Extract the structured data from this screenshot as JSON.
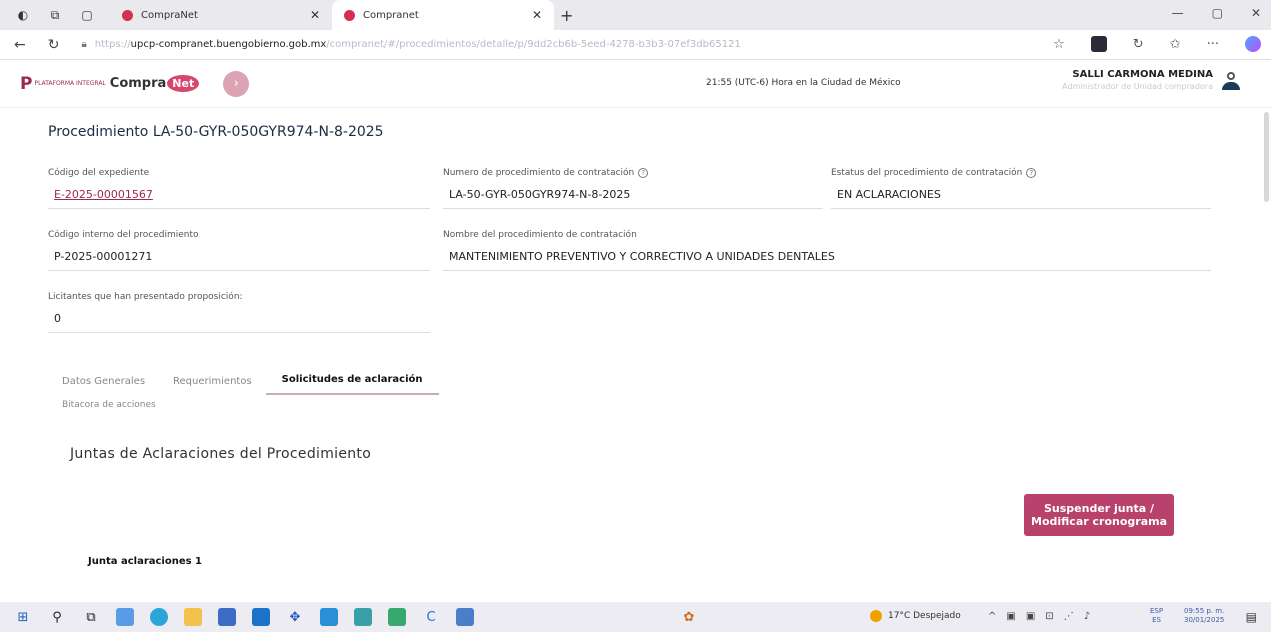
{
  "browser": {
    "tabs": [
      {
        "label": "CompraNet",
        "active": false
      },
      {
        "label": "Compranet",
        "active": true
      }
    ],
    "new_tab_icon": "plus-icon",
    "url_prefix": "https://",
    "url_host": "upcp-compranet.buengobierno.gob.mx",
    "url_path": "/compranet/#/procedimientos/detalle/p/9dd2cb6b-5eed-4278-b3b3-07ef3db65121"
  },
  "app": {
    "logo_platform": "PLATAFORMA INTEGRAL",
    "logo_compra": "Compra",
    "logo_net": "Net",
    "timezone_text": "21:55 (UTC-6) Hora en la Ciudad de México",
    "user_name": "SALLI CARMONA MEDINA",
    "user_role": "Administrador de Unidad compradora"
  },
  "procedure": {
    "title": "Procedimiento LA-50-GYR-050GYR974-N-8-2025",
    "expediente_label": "Código del expediente",
    "expediente_value": "E-2025-00001567",
    "numero_label": "Numero de procedimiento de contratación",
    "numero_value": "LA-50-GYR-050GYR974-N-8-2025",
    "estatus_label": "Estatus del procedimiento de contratación",
    "estatus_value": "EN ACLARACIONES",
    "codigo_interno_label": "Código interno del procedimiento",
    "codigo_interno_value": "P-2025-00001271",
    "nombre_label": "Nombre del procedimiento de contratación",
    "nombre_value": "MANTENIMIENTO PREVENTIVO Y CORRECTIVO A UNIDADES DENTALES",
    "licitantes_label": "Licitantes que han presentado proposición:",
    "licitantes_value": "0"
  },
  "tabs": {
    "datos_generales": "Datos Generales",
    "requerimientos": "Requerimientos",
    "solicitudes": "Solicitudes de aclaración",
    "bitacora": "Bitacora de acciones"
  },
  "juntas": {
    "section_title": "Juntas de Aclaraciones del Procedimiento",
    "suspend_button": "Suspender junta / Modificar cronograma",
    "junta_1": "Junta aclaraciones 1"
  },
  "taskbar": {
    "weather": "17°C Despejado",
    "lang_line1": "ESP",
    "lang_line2": "ES",
    "time": "09:55 p. m.",
    "date": "30/01/2025"
  },
  "colors": {
    "brand": "#9c2a4a",
    "button": "#b8426c",
    "title": "#1d2b45"
  }
}
